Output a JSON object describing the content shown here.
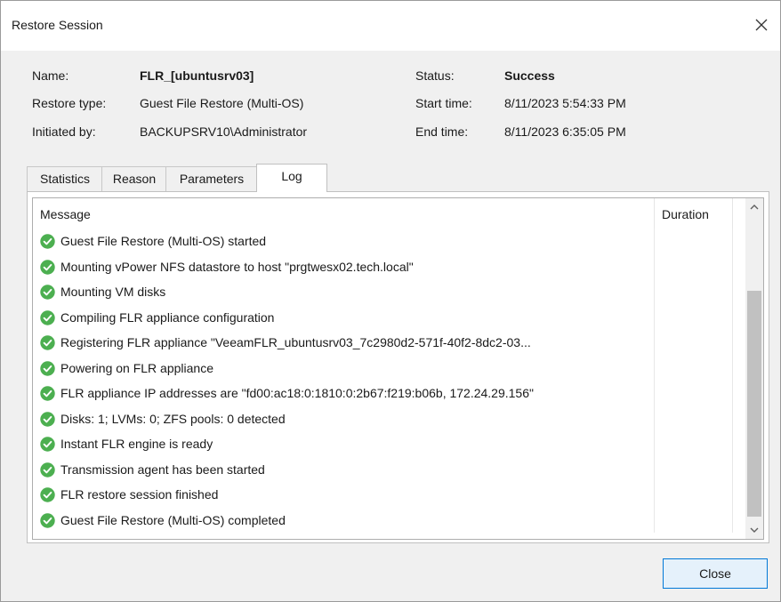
{
  "window": {
    "title": "Restore Session"
  },
  "info": {
    "name_label": "Name:",
    "name_value": "FLR_[ubuntusrv03]",
    "restore_type_label": "Restore type:",
    "restore_type_value": "Guest File Restore (Multi-OS)",
    "initiated_by_label": "Initiated by:",
    "initiated_by_value": "BACKUPSRV10\\Administrator",
    "status_label": "Status:",
    "status_value": "Success",
    "start_time_label": "Start time:",
    "start_time_value": "8/11/2023 5:54:33 PM",
    "end_time_label": "End time:",
    "end_time_value": "8/11/2023 6:35:05 PM"
  },
  "tabs": [
    {
      "label": "Statistics"
    },
    {
      "label": "Reason"
    },
    {
      "label": "Parameters"
    },
    {
      "label": "Log"
    }
  ],
  "active_tab": "Log",
  "log": {
    "columns": {
      "message": "Message",
      "duration": "Duration"
    },
    "rows": [
      {
        "icon": "success-check-icon",
        "message": "Guest File Restore (Multi-OS) started",
        "duration": ""
      },
      {
        "icon": "success-check-icon",
        "message": "Mounting vPower NFS datastore to host \"prgtwesx02.tech.local\"",
        "duration": ""
      },
      {
        "icon": "success-check-icon",
        "message": "Mounting VM disks",
        "duration": ""
      },
      {
        "icon": "success-check-icon",
        "message": "Compiling FLR appliance configuration",
        "duration": ""
      },
      {
        "icon": "success-check-icon",
        "message": "Registering FLR appliance \"VeeamFLR_ubuntusrv03_7c2980d2-571f-40f2-8dc2-03...",
        "duration": ""
      },
      {
        "icon": "success-check-icon",
        "message": "Powering on FLR appliance",
        "duration": ""
      },
      {
        "icon": "success-check-icon",
        "message": "FLR appliance IP addresses are \"fd00:ac18:0:1810:0:2b67:f219:b06b, 172.24.29.156\"",
        "duration": ""
      },
      {
        "icon": "success-check-icon",
        "message": "Disks: 1; LVMs: 0; ZFS pools: 0 detected",
        "duration": ""
      },
      {
        "icon": "success-check-icon",
        "message": "Instant FLR engine is ready",
        "duration": ""
      },
      {
        "icon": "success-check-icon",
        "message": "Transmission agent has been started",
        "duration": ""
      },
      {
        "icon": "success-check-icon",
        "message": "FLR restore session finished",
        "duration": ""
      },
      {
        "icon": "success-check-icon",
        "message": "Guest File Restore (Multi-OS) completed",
        "duration": ""
      }
    ]
  },
  "buttons": {
    "close_label": "Close"
  },
  "colors": {
    "success": "#4caf50",
    "accent": "#0078d7",
    "button_bg": "#e5f1fb"
  }
}
